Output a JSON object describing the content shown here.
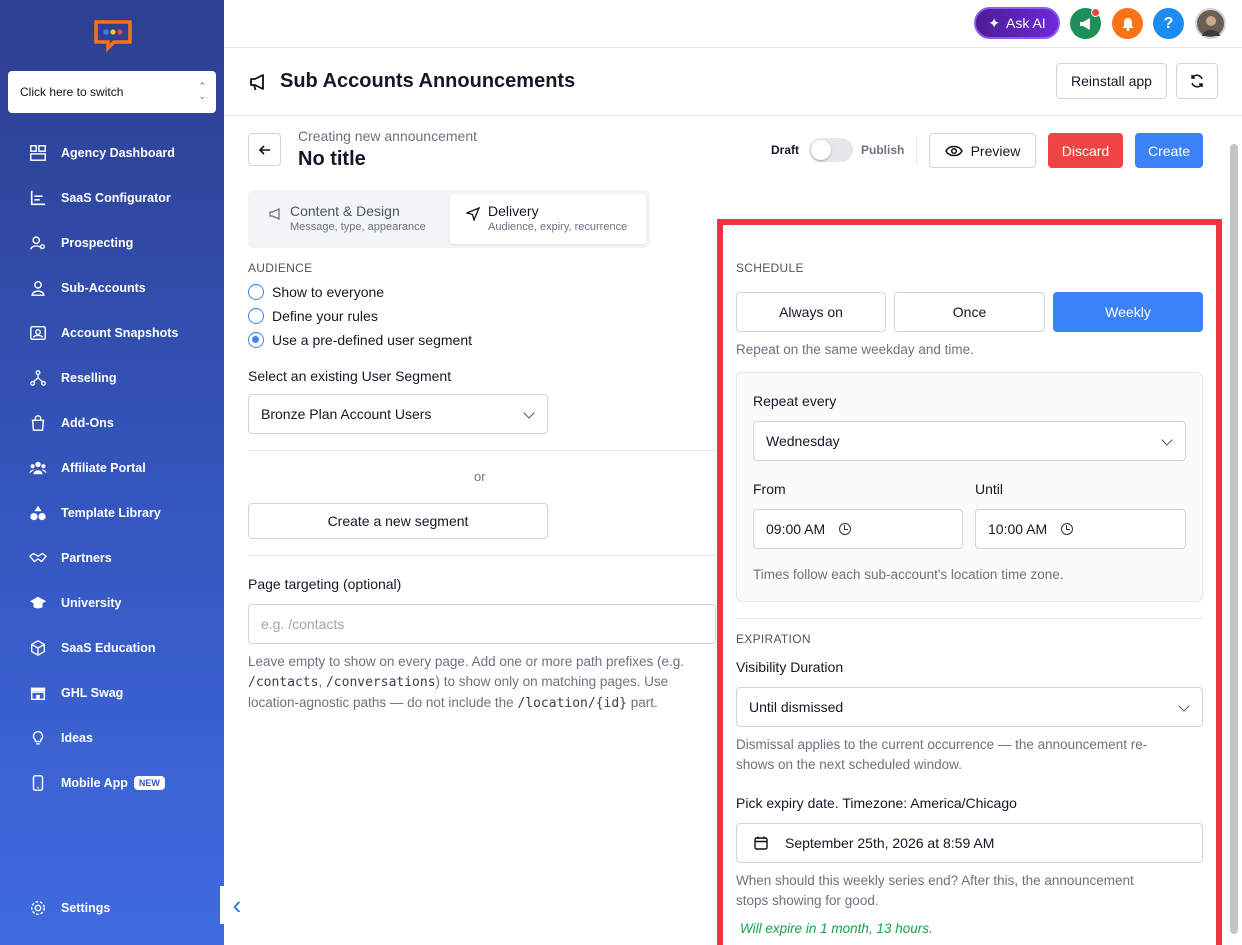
{
  "sidebar": {
    "switcher_label": "Click here to switch",
    "items": [
      {
        "label": "Agency Dashboard",
        "icon": "dashboard-icon"
      },
      {
        "label": "SaaS Configurator",
        "icon": "chart-icon"
      },
      {
        "label": "Prospecting",
        "icon": "person-search-icon"
      },
      {
        "label": "Sub-Accounts",
        "icon": "user-icon"
      },
      {
        "label": "Account Snapshots",
        "icon": "snapshot-icon"
      },
      {
        "label": "Reselling",
        "icon": "network-icon"
      },
      {
        "label": "Add-Ons",
        "icon": "bag-icon"
      },
      {
        "label": "Affiliate Portal",
        "icon": "group-icon"
      },
      {
        "label": "Template Library",
        "icon": "shapes-icon"
      },
      {
        "label": "Partners",
        "icon": "handshake-icon"
      },
      {
        "label": "University",
        "icon": "graduation-cap-icon"
      },
      {
        "label": "SaaS Education",
        "icon": "cube-icon"
      },
      {
        "label": "GHL Swag",
        "icon": "store-icon"
      },
      {
        "label": "Ideas",
        "icon": "lightbulb-icon"
      },
      {
        "label": "Mobile App",
        "icon": "mobile-icon",
        "badge": "NEW"
      }
    ],
    "settings_label": "Settings"
  },
  "topbar": {
    "ask_ai_label": "Ask AI",
    "help_label": "?"
  },
  "header": {
    "title": "Sub Accounts Announcements",
    "reinstall_label": "Reinstall app"
  },
  "editor": {
    "subtitle": "Creating new announcement",
    "title": "No title",
    "draft_label": "Draft",
    "publish_label": "Publish",
    "preview_label": "Preview",
    "discard_label": "Discard",
    "create_label": "Create"
  },
  "tabs": [
    {
      "title": "Content & Design",
      "subtitle": "Message, type, appearance"
    },
    {
      "title": "Delivery",
      "subtitle": "Audience, expiry, recurrence"
    }
  ],
  "audience": {
    "heading": "AUDIENCE",
    "options": [
      "Show to everyone",
      "Define your rules",
      "Use a pre-defined user segment"
    ],
    "selected_index": 2,
    "segment_label": "Select an existing User Segment",
    "segment_value": "Bronze Plan Account Users",
    "or_label": "or",
    "create_segment_label": "Create a new segment"
  },
  "targeting": {
    "label": "Page targeting (optional)",
    "placeholder": "e.g. /contacts",
    "help_1": "Leave empty to show on every page. Add one or more path prefixes (e.g.",
    "help_code_1": "/contacts",
    "help_sep": ", ",
    "help_code_2": "/conversations",
    "help_2": ") to show only on matching pages. Use",
    "help_3": "location-agnostic paths — do not include the",
    "help_code_3": "/location/{id}",
    "help_4": "part."
  },
  "schedule": {
    "heading": "SCHEDULE",
    "options": [
      "Always on",
      "Once",
      "Weekly"
    ],
    "selected": "Weekly",
    "description": "Repeat on the same weekday and time.",
    "repeat_label": "Repeat every",
    "repeat_value": "Wednesday",
    "from_label": "From",
    "from_value": "09:00 AM",
    "until_label": "Until",
    "until_value": "10:00 AM",
    "tz_note": "Times follow each sub-account's location time zone."
  },
  "expiration": {
    "heading": "EXPIRATION",
    "duration_label": "Visibility Duration",
    "duration_value": "Until dismissed",
    "dismiss_note_1": "Dismissal applies to the current occurrence — the announcement re-",
    "dismiss_note_2": "shows on the next scheduled window.",
    "expiry_label": "Pick expiry date. Timezone: America/Chicago",
    "expiry_value": "September 25th, 2026 at 8:59 AM",
    "series_note_1": "When should this weekly series end? After this, the announcement",
    "series_note_2": "stops showing for good.",
    "expire_status": "Will expire in 1 month, 13 hours."
  },
  "colors": {
    "primary": "#3b82f6",
    "danger": "#ef4444",
    "highlight_outline": "#ef3340",
    "success_text": "#16a34a"
  }
}
